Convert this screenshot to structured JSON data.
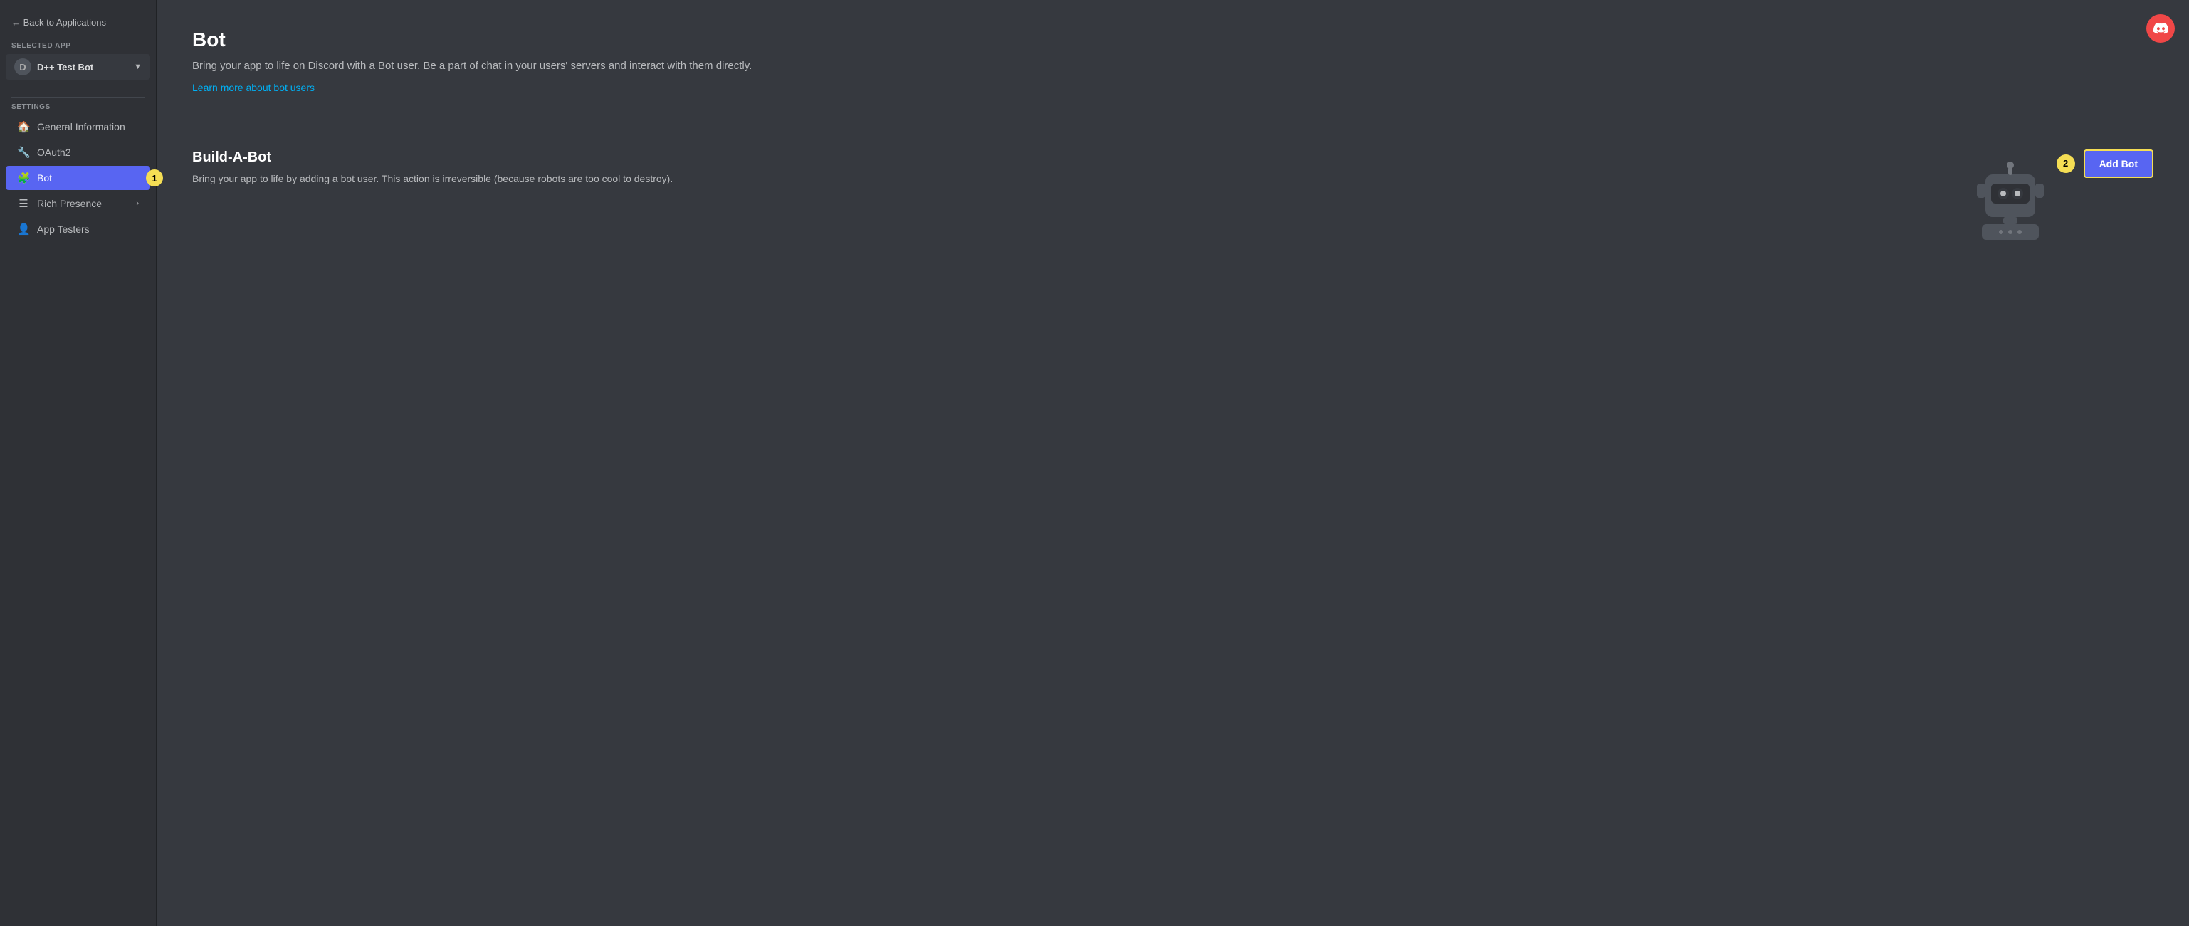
{
  "sidebar": {
    "back_label": "← Back to Applications",
    "selected_app_label": "SELECTED APP",
    "app_name": "D++ Test Bot",
    "settings_label": "SETTINGS",
    "nav_items": [
      {
        "id": "general-information",
        "label": "General Information",
        "icon": "🏠",
        "active": false,
        "chevron": false
      },
      {
        "id": "oauth2",
        "label": "OAuth2",
        "icon": "🔧",
        "active": false,
        "chevron": false
      },
      {
        "id": "bot",
        "label": "Bot",
        "icon": "🧩",
        "active": true,
        "chevron": false,
        "annotation": "1"
      },
      {
        "id": "rich-presence",
        "label": "Rich Presence",
        "icon": "≡",
        "active": false,
        "chevron": true
      },
      {
        "id": "app-testers",
        "label": "App Testers",
        "icon": "👤",
        "active": false,
        "chevron": false
      }
    ]
  },
  "main": {
    "page_title": "Bot",
    "page_subtitle": "Bring your app to life on Discord with a Bot user. Be a part of chat in your users' servers and interact with them directly.",
    "learn_more_text": "Learn more about bot users",
    "build_a_bot": {
      "title": "Build-A-Bot",
      "description": "Bring your app to life by adding a bot user. This action is irreversible (because robots are too cool to destroy).",
      "add_bot_label": "Add Bot",
      "annotation": "2"
    }
  }
}
